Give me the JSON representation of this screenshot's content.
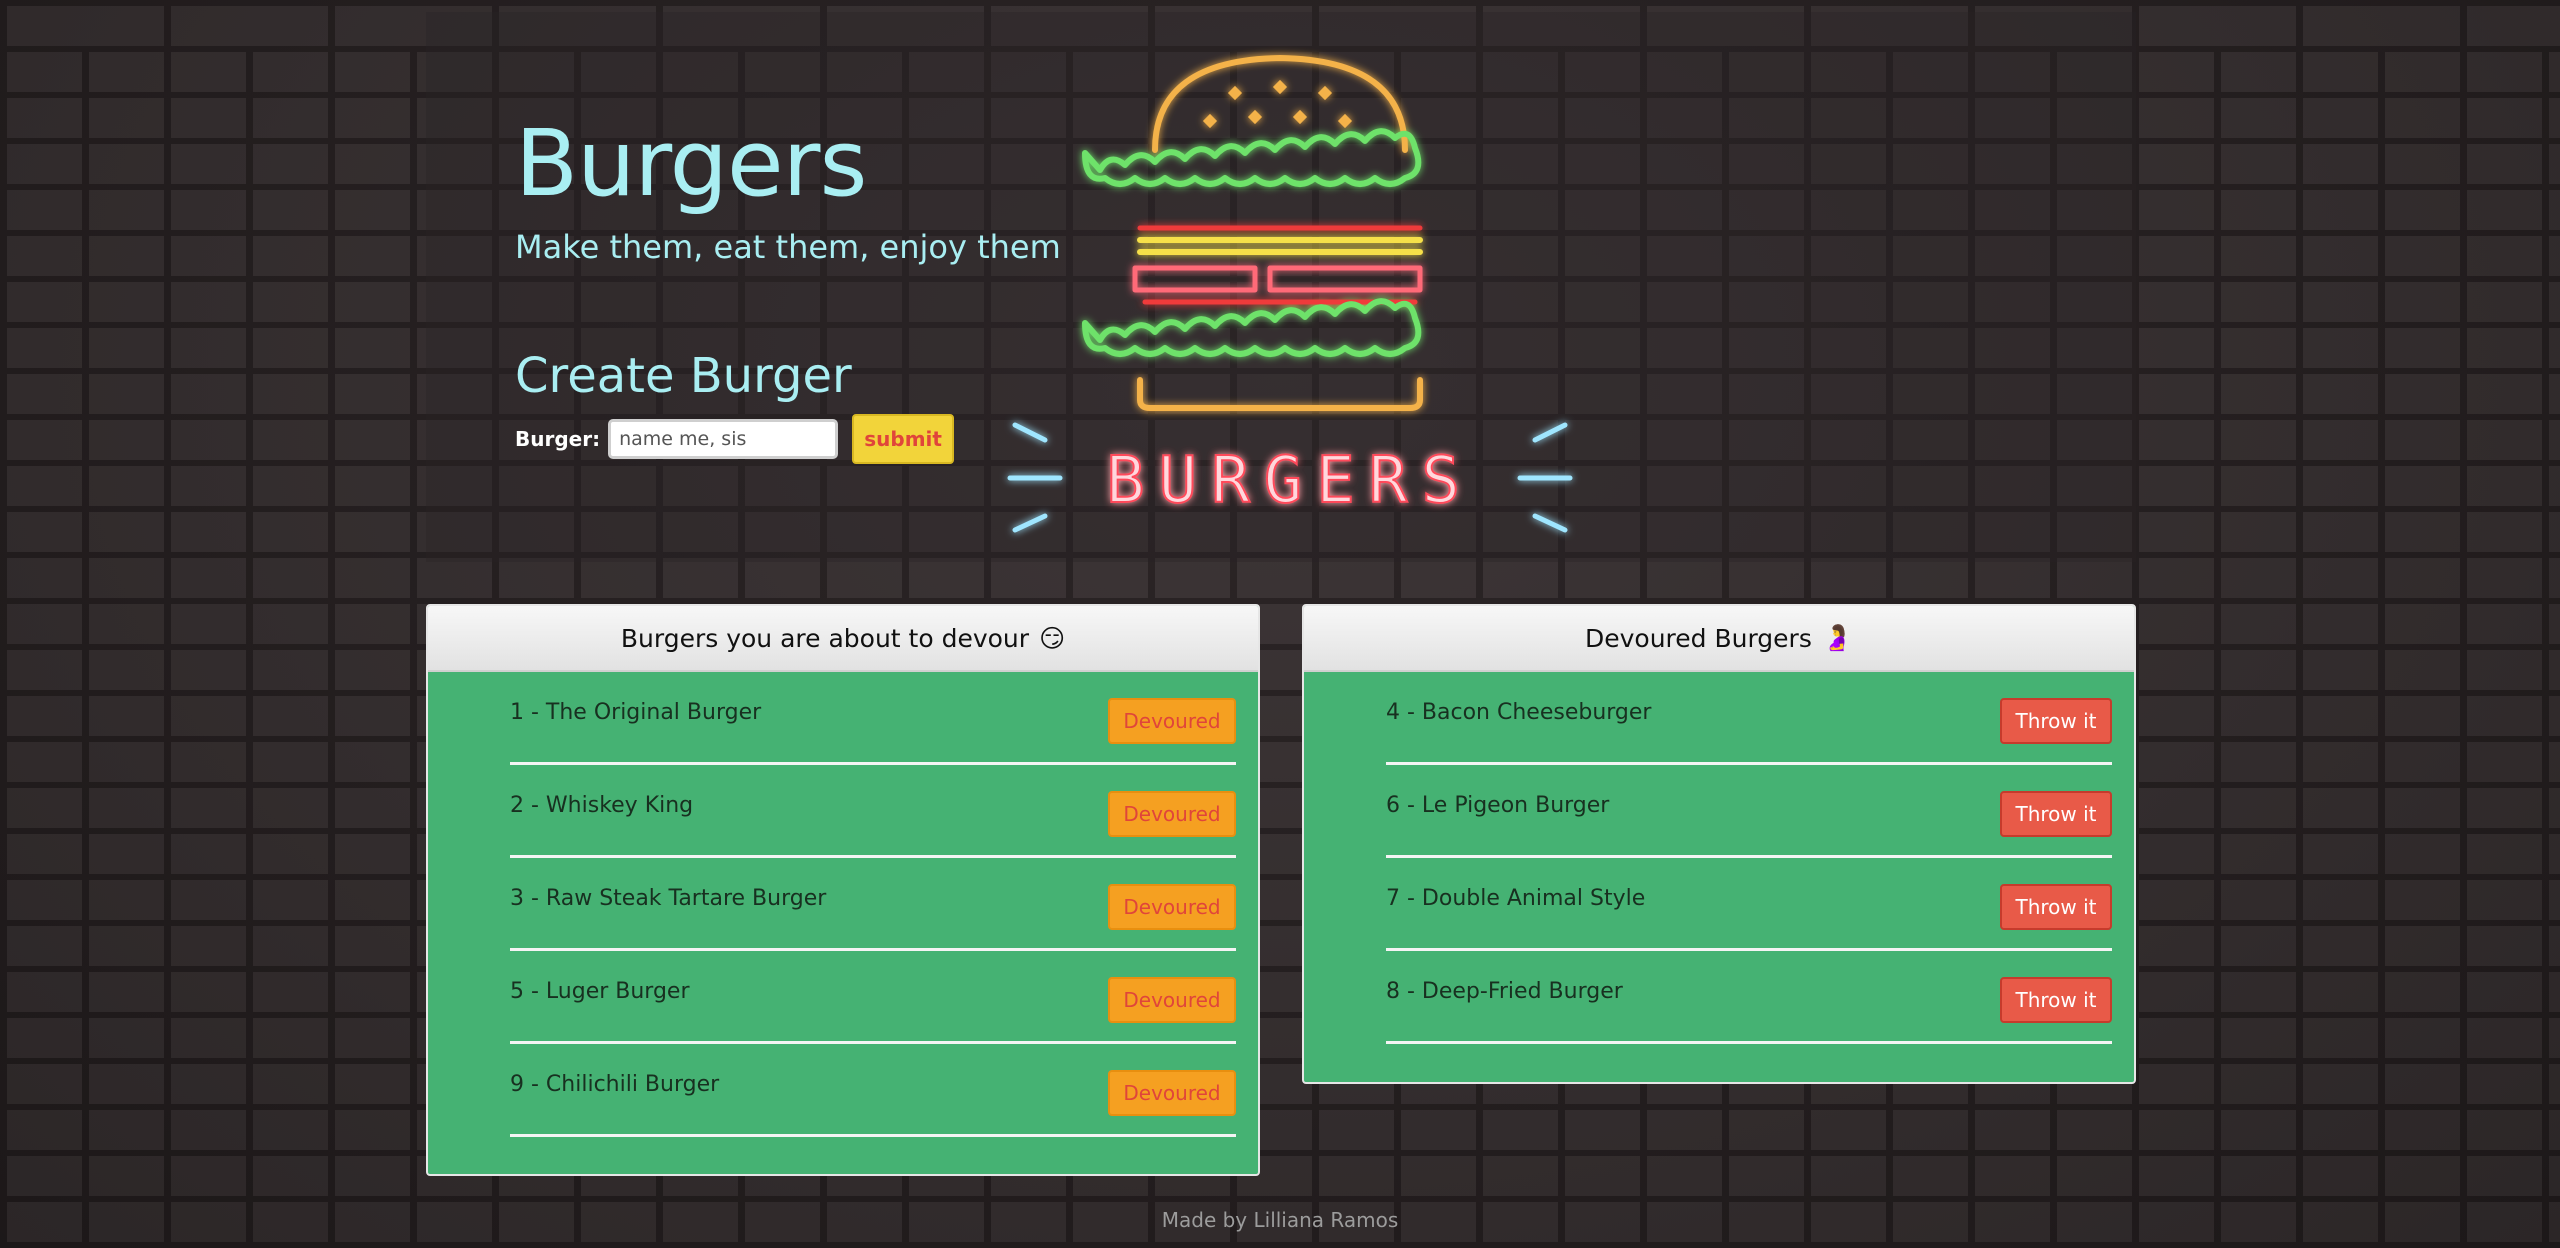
{
  "header": {
    "title": "Burgers",
    "subtitle": "Make them, eat them, enjoy them"
  },
  "create": {
    "heading": "Create Burger",
    "label": "Burger:",
    "placeholder": "name me, sis",
    "submit_label": "submit"
  },
  "neon_sign": {
    "text": "BURGERS"
  },
  "devour_card": {
    "title": "Burgers you are about to devour",
    "emoji": "😏",
    "button_label": "Devoured",
    "items": [
      "1 - The Original Burger",
      "2 - Whiskey King",
      "3 - Raw Steak Tartare Burger",
      "5 - Luger Burger",
      "9 - Chilichili Burger"
    ]
  },
  "devoured_card": {
    "title": "Devoured Burgers",
    "emoji": "🤰",
    "button_label": "Throw it",
    "items": [
      "4 - Bacon Cheeseburger",
      "6 - Le Pigeon Burger",
      "7 - Double Animal Style",
      "8 - Deep-Fried Burger"
    ]
  },
  "footer": {
    "text": "Made by Lilliana Ramos"
  },
  "colors": {
    "title": "#a9eef2",
    "card_body": "#45b273",
    "devoured_button": "#f5a021",
    "throw_button": "#e85a48",
    "submit_button": "#f2d43a"
  }
}
